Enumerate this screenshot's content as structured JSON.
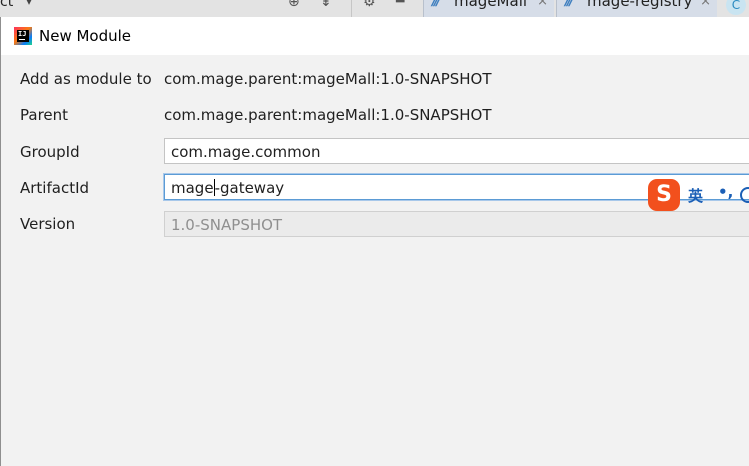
{
  "ide": {
    "project_label": "ct",
    "tabs": [
      {
        "label": "mageMall",
        "close": "×"
      },
      {
        "label": "mage-registry",
        "close": "×"
      }
    ],
    "extra_tab_glyph": "C"
  },
  "dialog": {
    "title": "New Module",
    "rows": {
      "add_as_module_to": {
        "label": "Add as module to",
        "value": "com.mage.parent:mageMall:1.0-SNAPSHOT"
      },
      "parent": {
        "label": "Parent",
        "value": "com.mage.parent:mageMall:1.0-SNAPSHOT"
      },
      "group_id": {
        "label": "GroupId",
        "value": "com.mage.common"
      },
      "artifact_id": {
        "label": "ArtifactId",
        "value_before_caret": "mage",
        "value_after_caret": "-gateway"
      },
      "version": {
        "label": "Version",
        "value": "1.0-SNAPSHOT"
      }
    }
  },
  "ime": {
    "logo_glyph": "S",
    "language": "英",
    "punct": "•,"
  }
}
